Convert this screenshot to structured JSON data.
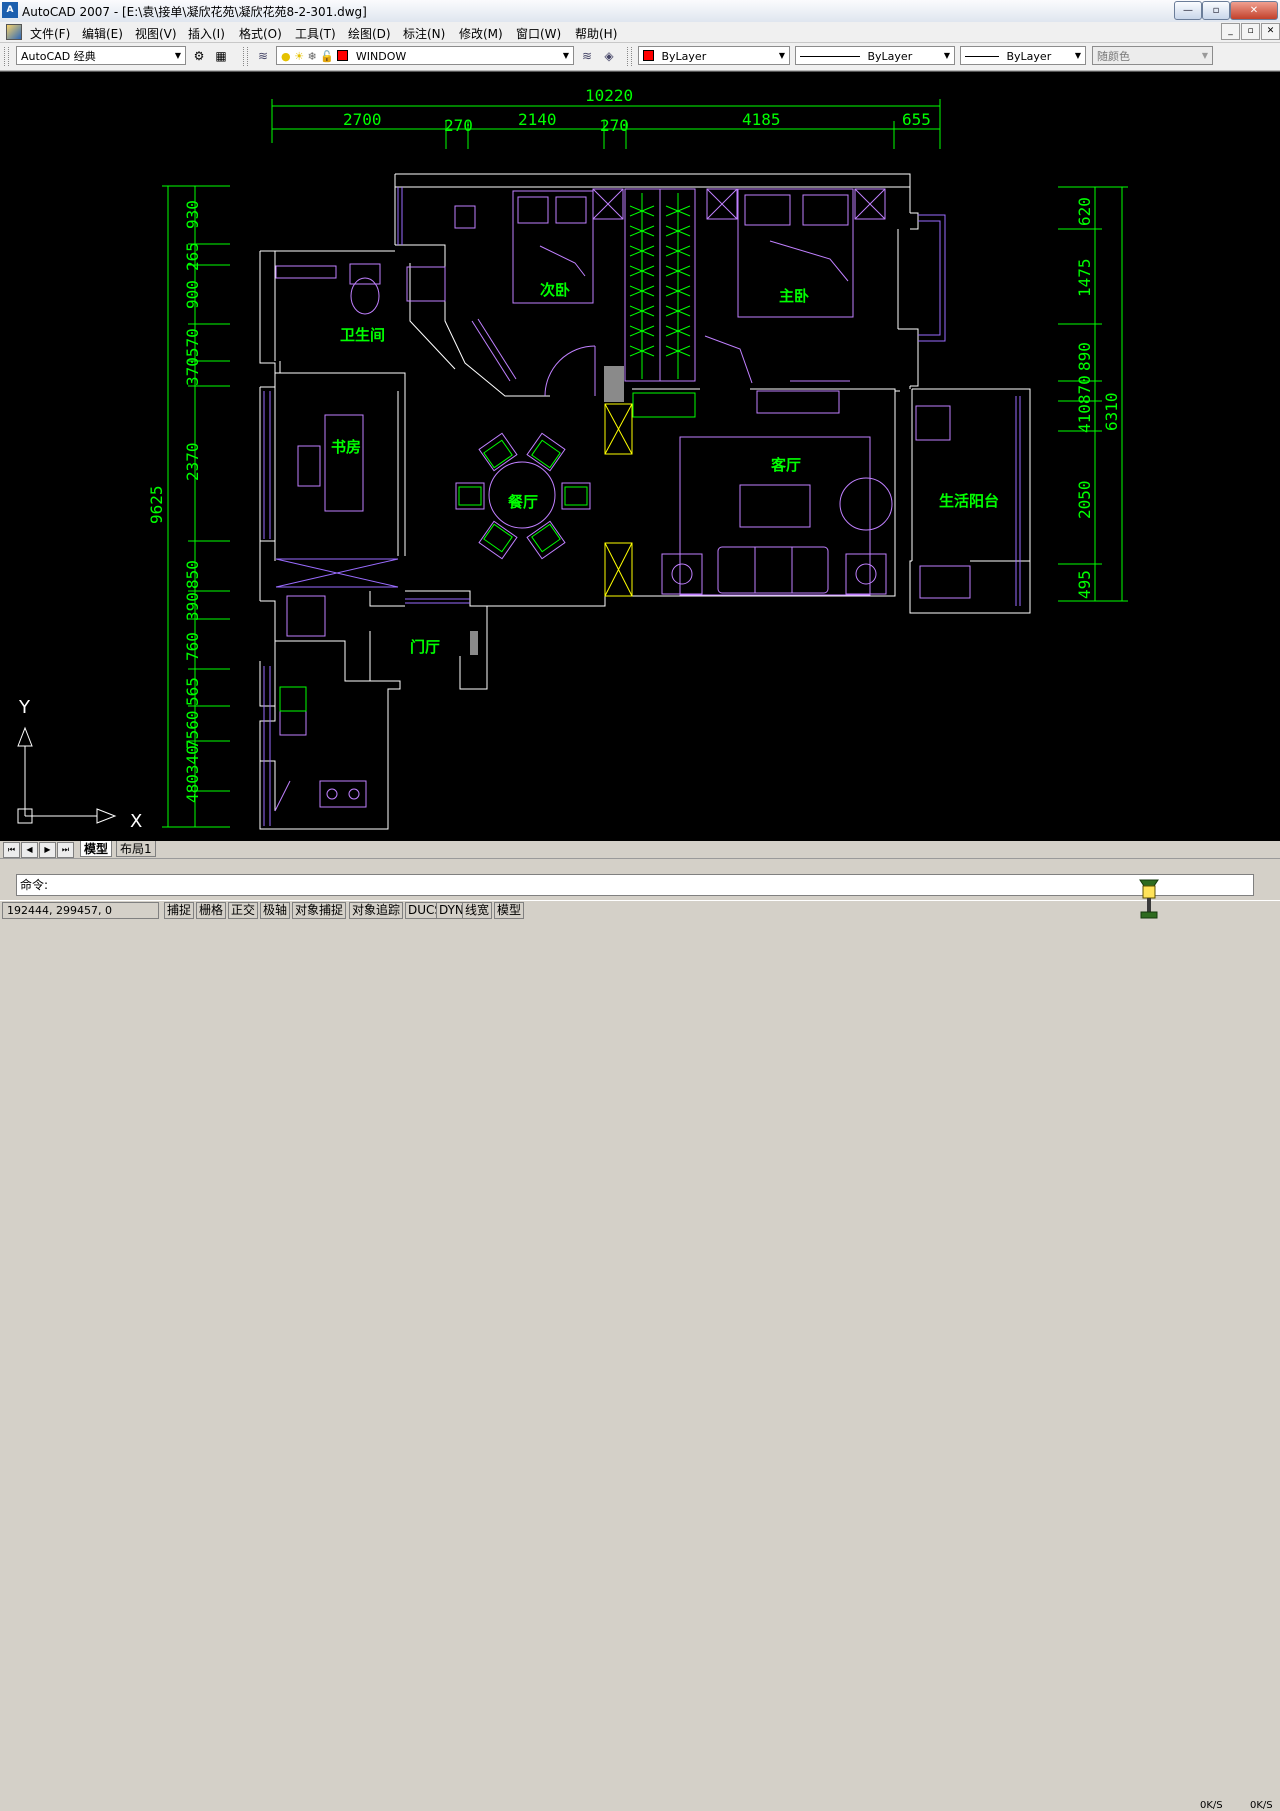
{
  "window": {
    "app_icon_text": "A",
    "title": "AutoCAD 2007 - [E:\\袁\\接单\\凝欣花苑\\凝欣花苑8-2-301.dwg]",
    "minimize": "—",
    "maximize": "▫",
    "close": "✕"
  },
  "menu": {
    "items": [
      "文件(F)",
      "编辑(E)",
      "视图(V)",
      "插入(I)",
      "格式(O)",
      "工具(T)",
      "绘图(D)",
      "标注(N)",
      "修改(M)",
      "窗口(W)",
      "帮助(H)"
    ],
    "doc_min": "_",
    "doc_restore": "▫",
    "doc_close": "✕"
  },
  "toolbar": {
    "workspace": "AutoCAD 经典",
    "layer": "WINDOW",
    "color": "ByLayer",
    "linetype": "ByLayer",
    "lineweight": "ByLayer",
    "plotstyle": "随颜色",
    "layer_color": "#ff0000"
  },
  "drawing": {
    "rooms": [
      "次卧",
      "主卧",
      "卫生间",
      "书房",
      "餐厅",
      "客厅",
      "生活阳台",
      "门厅"
    ],
    "dim_top_total": "10220",
    "dim_top_segments": [
      "2700",
      "270",
      "2140",
      "270",
      "4185",
      "655"
    ],
    "dim_left_total": "9625",
    "dim_left_segments": [
      "930",
      "265",
      "900",
      "370570",
      "2370",
      "850",
      "390",
      "760",
      "565",
      "7560",
      "480340"
    ],
    "dim_right_total": "6310",
    "dim_right_segments": [
      "620",
      "1475",
      "890",
      "410870",
      "2050",
      "495"
    ],
    "ucs_y": "Y",
    "ucs_x": "X",
    "colors": {
      "wall": "#ffffff",
      "furniture": "#c080ff",
      "dimension": "#00ff00",
      "text": "#00ff00",
      "accent": "#ffff00"
    }
  },
  "tabs": {
    "nav": [
      "⏮",
      "◀",
      "▶",
      "⏭"
    ],
    "items": [
      "模型",
      "布局1"
    ]
  },
  "command": {
    "prompt": "命令:"
  },
  "status": {
    "coords": "192444, 299457, 0",
    "buttons": [
      "捕捉",
      "栅格",
      "正交",
      "极轴",
      "对象捕捉",
      "对象追踪",
      "DUCS",
      "DYN",
      "线宽",
      "模型"
    ],
    "speed_up": "0K/S",
    "speed_down": "0K/S"
  }
}
